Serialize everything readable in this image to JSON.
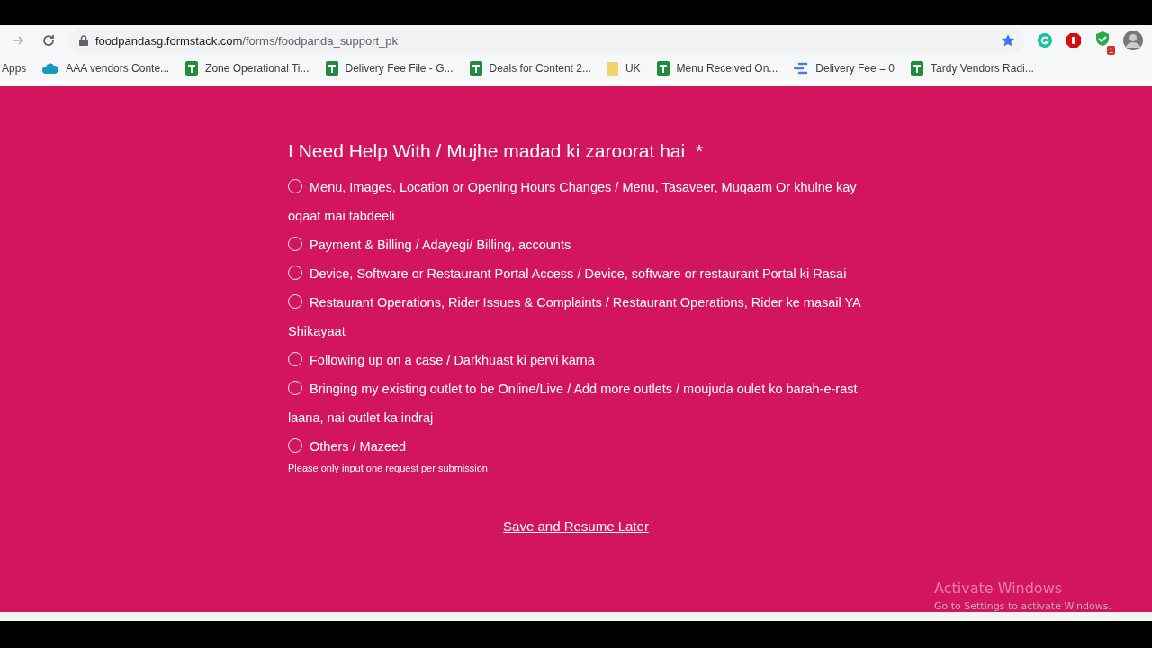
{
  "browser": {
    "address": {
      "host": "foodpandasg.formstack.com",
      "path": "/forms/foodpanda_support_pk"
    },
    "bookmarks": [
      {
        "label": "Apps",
        "kind": "apps"
      },
      {
        "label": "AAA vendors Conte...",
        "kind": "cloud"
      },
      {
        "label": "Zone Operational Ti...",
        "kind": "sheet"
      },
      {
        "label": "Delivery Fee File - G...",
        "kind": "sheet"
      },
      {
        "label": "Deals for Content 2...",
        "kind": "sheet"
      },
      {
        "label": "UK",
        "kind": "folder"
      },
      {
        "label": "Menu Received On...",
        "kind": "sheet"
      },
      {
        "label": "Delivery Fee = 0",
        "kind": "flow"
      },
      {
        "label": "Tardy Vendors Radi...",
        "kind": "sheet"
      }
    ],
    "extension_badge": "1"
  },
  "form": {
    "question": "I Need Help With / Mujhe madad ki zaroorat hai",
    "required_mark": "*",
    "options": [
      {
        "label": "Menu, Images, Location or Opening Hours Changes / Menu, Tasaveer, Muqaam Or khulne kay oqaat mai tabdeeli",
        "selected": false
      },
      {
        "label": "Payment & Billing / Adayegi/ Billing, accounts",
        "selected": false
      },
      {
        "label": "Device, Software or Restaurant Portal Access / Device, software or restaurant Portal ki Rasai",
        "selected": false
      },
      {
        "label": "Restaurant Operations, Rider Issues & Complaints / Restaurant Operations, Rider ke masail YA Shikayaat",
        "selected": false
      },
      {
        "label": "Following up on a case / Darkhuast ki pervi karna",
        "selected": false
      },
      {
        "label": "Bringing my existing outlet to be Online/Live / Add more outlets / moujuda oulet ko barah-e-rast laana, nai outlet ka indraj",
        "selected": false
      },
      {
        "label": "Others / Mazeed",
        "selected": false
      }
    ],
    "hint": "Please only input one request per submission",
    "save_link": "Save and Resume Later"
  },
  "os_notice": {
    "title": "Activate Windows",
    "subtitle": "Go to Settings to activate Windows."
  }
}
